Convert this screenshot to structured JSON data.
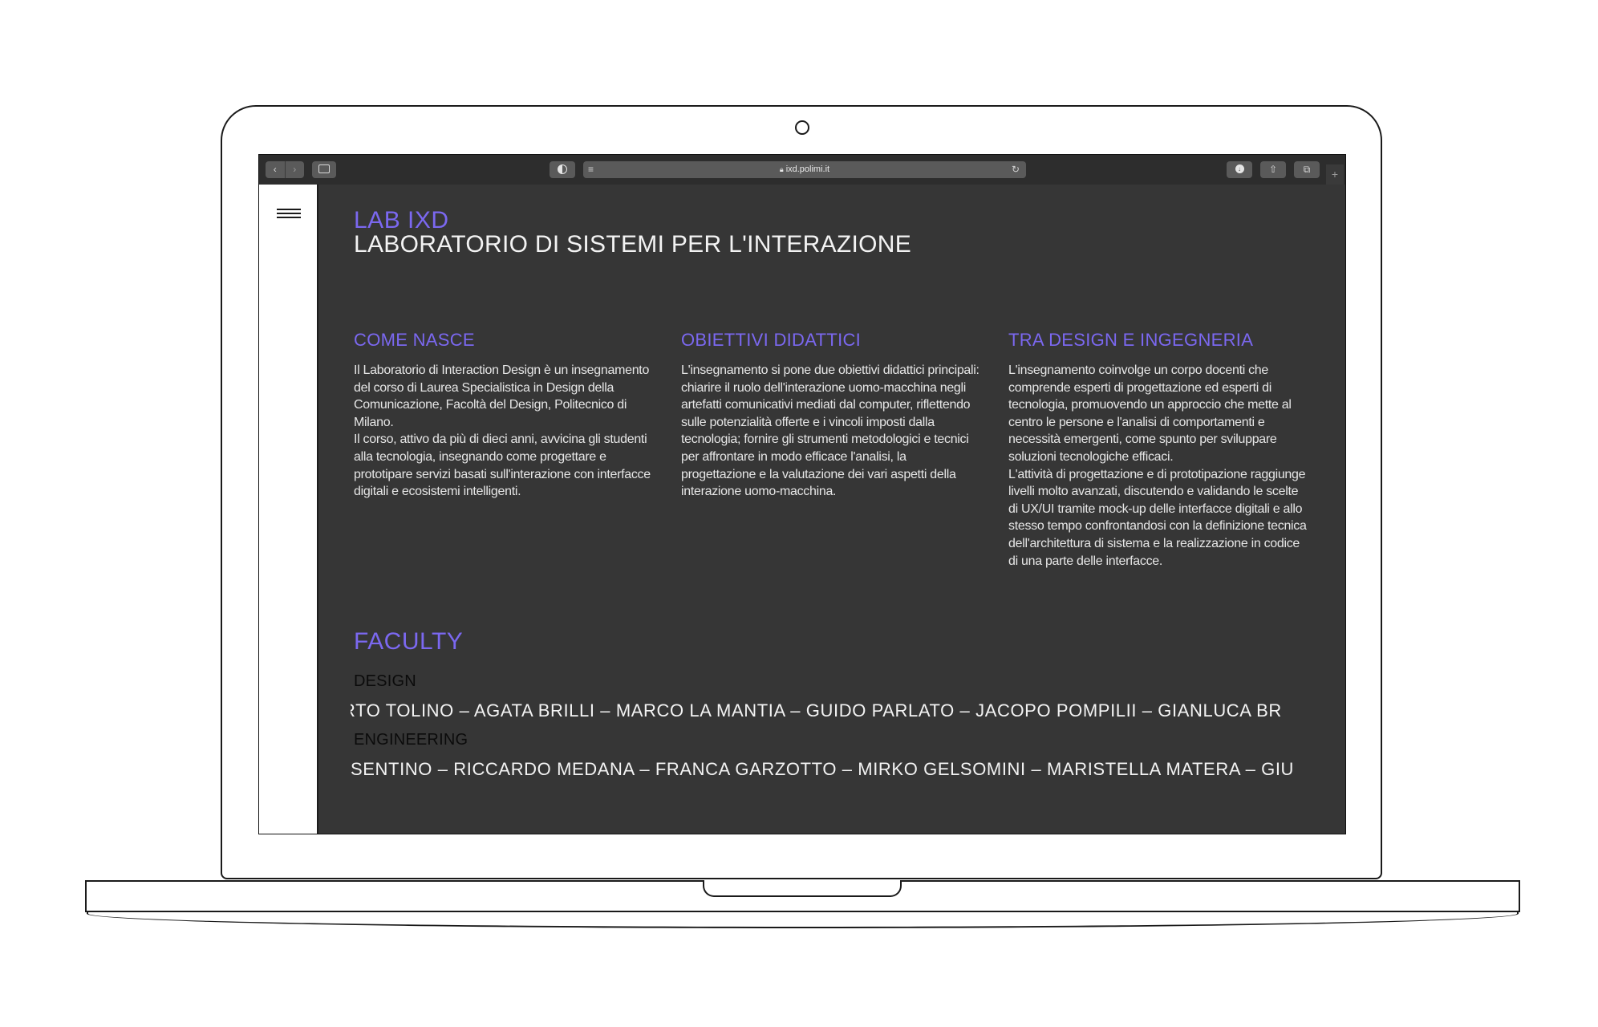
{
  "browser": {
    "url": "ixd.polimi.it",
    "icons": {
      "back": "chevron-left-icon",
      "forward": "chevron-right-icon",
      "sidebar": "sidebar-icon",
      "privacy": "shield-icon",
      "reader": "reader-icon",
      "reload": "reload-icon",
      "download": "download-icon",
      "share": "share-icon",
      "tabs": "tabs-icon",
      "new_tab": "plus-icon"
    }
  },
  "header": {
    "title_small": "LAB IXD",
    "title_big": "LABORATORIO DI SISTEMI PER L'INTERAZIONE"
  },
  "columns": [
    {
      "heading": "COME NASCE",
      "text": "Il Laboratorio di Interaction Design è un insegnamento del corso di Laurea Specialistica in Design della Comunicazione, Facoltà del Design, Politecnico di Milano.\nIl corso, attivo da più di dieci anni, avvicina gli studenti alla tecnologia, insegnando come progettare e prototipare servizi basati sull'interazione con interfacce digitali e ecosistemi intelligenti."
    },
    {
      "heading": "OBIETTIVI DIDATTICI",
      "text": "L'insegnamento si pone due obiettivi didattici principali: chiarire il ruolo dell'interazione uomo-macchina negli artefatti comunicativi mediati dal computer, riflettendo sulle potenzialità offerte e i vincoli imposti dalla tecnologia; fornire gli strumenti metodologici e tecnici per affrontare in modo efficace l'analisi, la progettazione e la valutazione dei vari aspetti della interazione uomo-macchina."
    },
    {
      "heading": "TRA DESIGN E INGEGNERIA",
      "text": "L'insegnamento coinvolge un corpo docenti che comprende esperti di progettazione ed esperti di tecnologia, promuovendo un approccio che mette al centro le persone e l'analisi di comportamenti e necessità emergenti, come spunto per sviluppare soluzioni tecnologiche efficaci.\nL'attività di progettazione e di prototipazione raggiunge livelli molto avanzati, discutendo e validando le scelte di UX/UI tramite mock-up delle interfacce digitali e allo stesso tempo confrontandosi con la definizione tecnica dell'architettura di sistema e la realizzazione in codice di una parte delle interfacce."
    }
  ],
  "faculty": {
    "title": "FACULTY",
    "design_label": "DESIGN",
    "design_names": "RTO TOLINO – AGATA BRILLI – MARCO LA MANTIA – GUIDO PARLATO – JACOPO POMPILII – GIANLUCA BR",
    "engineering_label": "ENGINEERING",
    "engineering_names": "SENTINO – RICCARDO MEDANA – FRANCA GARZOTTO – MIRKO GELSOMINI – MARISTELLA MATERA – GIU"
  },
  "colors": {
    "accent": "#7b68f0",
    "page_bg": "#363636",
    "text": "#f3f3f3"
  }
}
